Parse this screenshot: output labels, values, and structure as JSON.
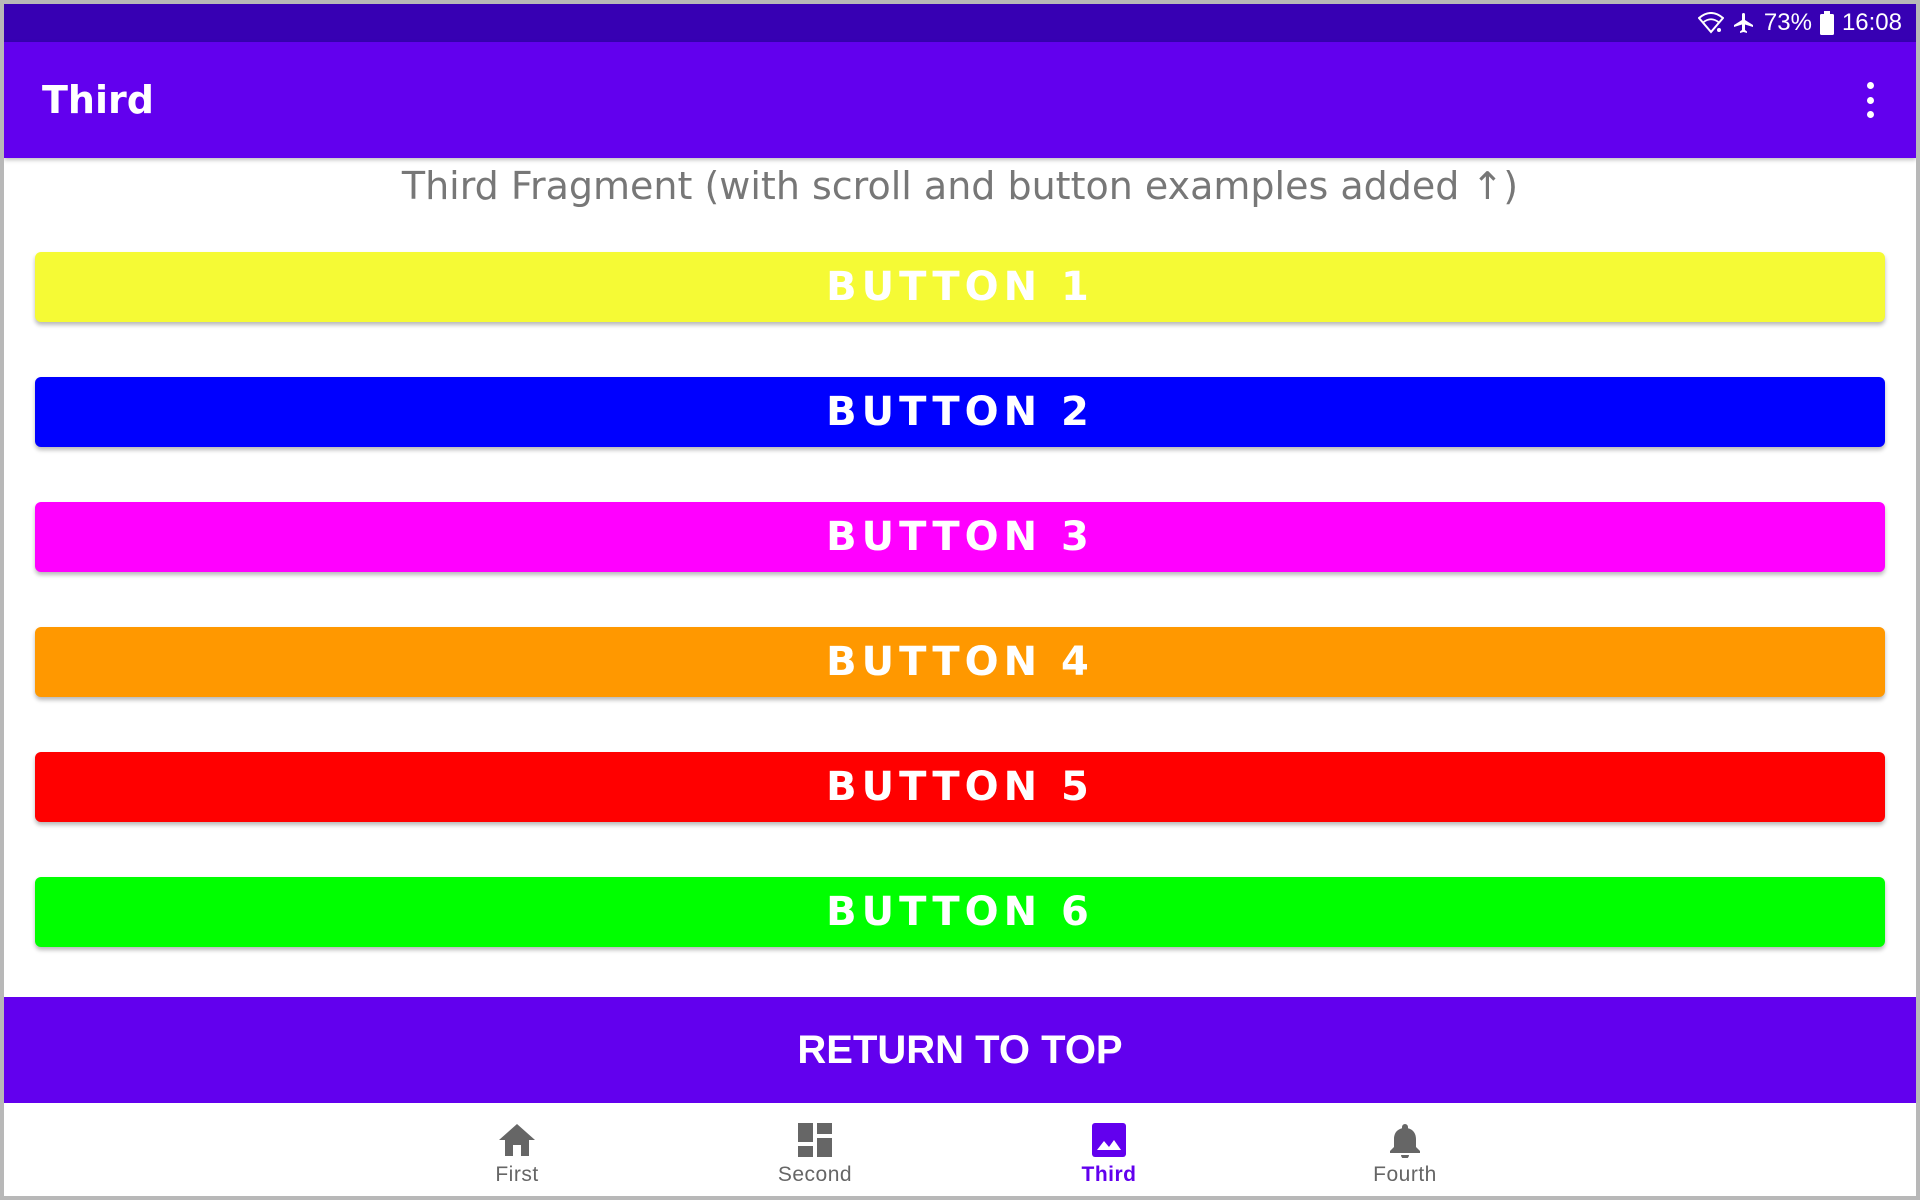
{
  "status_bar": {
    "battery_percent": "73%",
    "time": "16:08",
    "icons": [
      "wifi-icon",
      "airplane-icon",
      "battery-icon"
    ]
  },
  "app_bar": {
    "title": "Third",
    "menu_icon": "more-vert-icon"
  },
  "content": {
    "heading": "Third Fragment  (with scroll and button examples added ↑)",
    "buttons": [
      {
        "label": "BUTTON 1",
        "color": "#f5fa35"
      },
      {
        "label": "BUTTON 2",
        "color": "#0000ff"
      },
      {
        "label": "BUTTON 3",
        "color": "#ff00ff"
      },
      {
        "label": "BUTTON 4",
        "color": "#ff9800"
      },
      {
        "label": "BUTTON 5",
        "color": "#ff0000"
      },
      {
        "label": "BUTTON 6",
        "color": "#00ff00"
      }
    ],
    "return_label": "RETURN TO TOP"
  },
  "bottom_nav": {
    "items": [
      {
        "label": "First",
        "icon": "home-icon",
        "active": false
      },
      {
        "label": "Second",
        "icon": "dashboard-icon",
        "active": false
      },
      {
        "label": "Third",
        "icon": "image-icon",
        "active": true
      },
      {
        "label": "Fourth",
        "icon": "bell-icon",
        "active": false
      }
    ]
  },
  "colors": {
    "primary": "#6200ee",
    "primary_dark": "#3700b3",
    "inactive_nav": "#666666"
  }
}
